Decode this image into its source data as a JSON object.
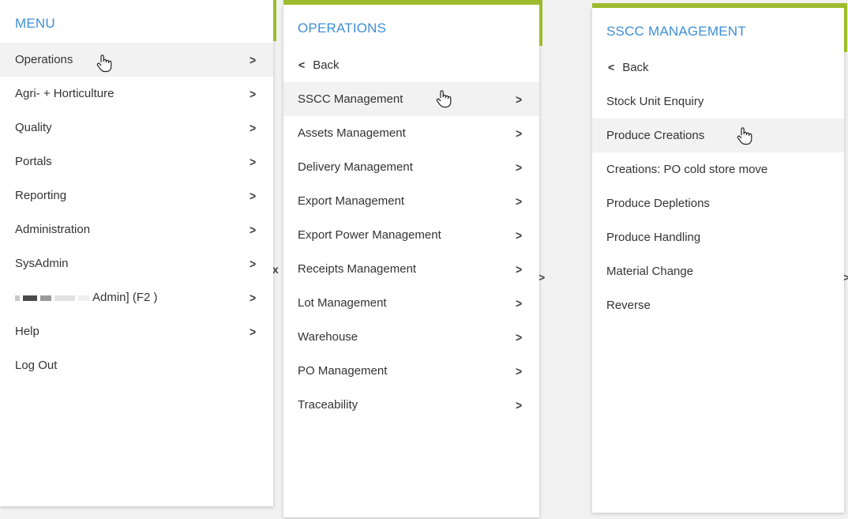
{
  "menu": {
    "title": "MENU",
    "items": [
      {
        "label": "Operations",
        "chevron": ">"
      },
      {
        "label": "Agri- + Horticulture",
        "chevron": ">"
      },
      {
        "label": "Quality",
        "chevron": ">"
      },
      {
        "label": "Portals",
        "chevron": ">"
      },
      {
        "label": "Reporting",
        "chevron": ">"
      },
      {
        "label": "Administration",
        "chevron": ">"
      },
      {
        "label": "SysAdmin",
        "chevron": ">"
      },
      {
        "label": "Admin] (F2 )",
        "chevron": ">"
      },
      {
        "label": "Help",
        "chevron": ">"
      },
      {
        "label": "Log Out",
        "chevron": ""
      }
    ]
  },
  "operations": {
    "title": "OPERATIONS",
    "back": {
      "chevron": "<",
      "label": "Back"
    },
    "items": [
      {
        "label": "SSCC Management",
        "chevron": ">"
      },
      {
        "label": "Assets Management",
        "chevron": ">"
      },
      {
        "label": "Delivery Management",
        "chevron": ">"
      },
      {
        "label": "Export Management",
        "chevron": ">"
      },
      {
        "label": "Export Power Management",
        "chevron": ">"
      },
      {
        "label": "Receipts Management",
        "chevron": ">"
      },
      {
        "label": "Lot Management",
        "chevron": ">"
      },
      {
        "label": "Warehouse",
        "chevron": ">"
      },
      {
        "label": "PO Management",
        "chevron": ">"
      },
      {
        "label": "Traceability",
        "chevron": ">"
      }
    ]
  },
  "sscc": {
    "title": "SSCC MANAGEMENT",
    "back": {
      "chevron": "<",
      "label": "Back"
    },
    "items": [
      {
        "label": "Stock Unit Enquiry"
      },
      {
        "label": "Produce Creations"
      },
      {
        "label": "Creations: PO cold store move"
      },
      {
        "label": "Produce Depletions"
      },
      {
        "label": "Produce Handling"
      },
      {
        "label": "Material Change"
      },
      {
        "label": "Reverse"
      }
    ]
  },
  "background": {
    "peek1": "x",
    "peek2": ">",
    "peek3": ">"
  },
  "colors": {
    "accent": "#9dbb2d",
    "title": "#3e8fd6",
    "highlight": "#f2f2f2"
  },
  "icons": {
    "pointer": "hand-pointer-icon"
  }
}
